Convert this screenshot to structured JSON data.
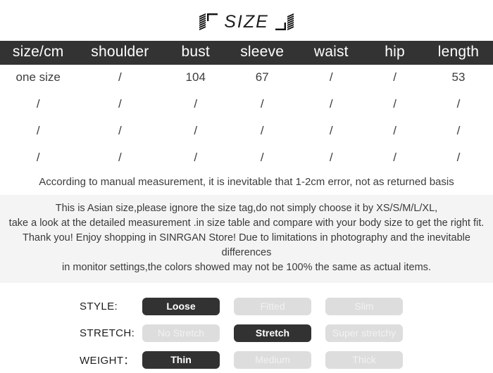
{
  "title": {
    "text": "SIZE",
    "left_ornament": "ruler-bracket-left-icon",
    "right_ornament": "ruler-bracket-right-icon"
  },
  "size_table": {
    "headers": [
      "size/cm",
      "shoulder",
      "bust",
      "sleeve",
      "waist",
      "hip",
      "length"
    ],
    "rows": [
      [
        "one size",
        "/",
        "104",
        "67",
        "/",
        "/",
        "53"
      ],
      [
        "/",
        "/",
        "/",
        "/",
        "/",
        "/",
        "/"
      ],
      [
        "/",
        "/",
        "/",
        "/",
        "/",
        "/",
        "/"
      ],
      [
        "/",
        "/",
        "/",
        "/",
        "/",
        "/",
        "/"
      ]
    ],
    "header_bg": "#333333",
    "header_color": "#ffffff"
  },
  "manual_note": "According to manual measurement, it is inevitable that 1-2cm error, not as returned basis",
  "description": {
    "background": "#f4f4f4",
    "lines": [
      "This is Asian size,please ignore the size tag,do not simply choose it by XS/S/M/L/XL,",
      "take a look at the detailed measurement .in size table and compare with your body size to get the right fit.",
      "Thank you! Enjoy shopping in SINRGAN Store!  Due to limitations in photography and the inevitable differences",
      "in monitor settings,the colors showed may not be 100% the same as actual items."
    ]
  },
  "attributes": {
    "active_color": "#323232",
    "inactive_color": "#dddddd",
    "rows": [
      {
        "label": "STYLE:",
        "options": [
          {
            "label": "Loose",
            "selected": true
          },
          {
            "label": "Fitted",
            "selected": false
          },
          {
            "label": "Slim",
            "selected": false
          }
        ]
      },
      {
        "label": "STRETCH:",
        "options": [
          {
            "label": "No Stretch",
            "selected": false
          },
          {
            "label": "Stretch",
            "selected": true
          },
          {
            "label": "Super stretchy",
            "selected": false
          }
        ]
      },
      {
        "label": "WEIGHT：",
        "options": [
          {
            "label": "Thin",
            "selected": true
          },
          {
            "label": "Medium",
            "selected": false
          },
          {
            "label": "Thick",
            "selected": false
          }
        ]
      }
    ]
  }
}
